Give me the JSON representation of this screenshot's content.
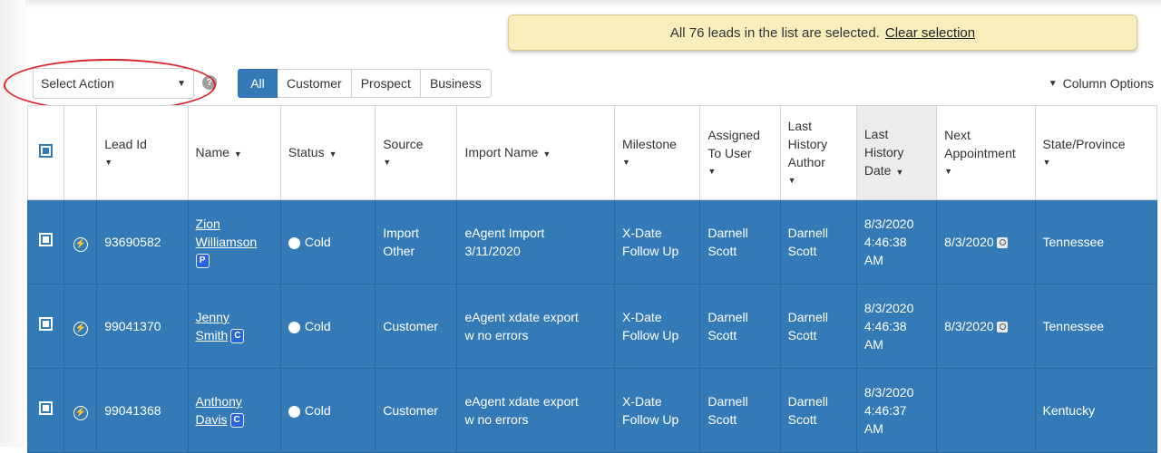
{
  "banner": {
    "text": "All 76 leads in the list are selected.",
    "clear_link": "Clear selection"
  },
  "toolbar": {
    "select_action": "Select Action",
    "help_glyph": "?",
    "tabs": [
      "All",
      "Customer",
      "Prospect",
      "Business"
    ],
    "column_options": "Column Options"
  },
  "table": {
    "headers": {
      "lead_id": "Lead Id",
      "name": "Name",
      "status": "Status",
      "source": "Source",
      "import_name": "Import Name",
      "milestone": "Milestone",
      "assigned_a": "Assigned",
      "assigned_b": "To User",
      "author_a": "Last",
      "author_b": "History",
      "author_c": "Author",
      "date_a": "Last",
      "date_b": "History",
      "date_c": "Date",
      "appt_a": "Next",
      "appt_b": "Appointment",
      "state": "State/Province"
    },
    "rows": [
      {
        "lead_id": "93690582",
        "first": "Zion",
        "last": "Williamson",
        "badge": "P",
        "status": "Cold",
        "source_a": "Import",
        "source_b": "Other",
        "import_a": "eAgent Import",
        "import_b": "3/11/2020",
        "milestone_a": "X-Date",
        "milestone_b": "Follow Up",
        "user_a": "Darnell",
        "user_b": "Scott",
        "author_a": "Darnell",
        "author_b": "Scott",
        "date_a": "8/3/2020",
        "date_b": "4:46:38",
        "date_c": "AM",
        "appointment": "8/3/2020",
        "state": "Tennessee"
      },
      {
        "lead_id": "99041370",
        "first": "Jenny",
        "last": "Smith",
        "badge": "C",
        "status": "Cold",
        "source_a": "Customer",
        "source_b": "",
        "import_a": "eAgent xdate export",
        "import_b": "w no errors",
        "milestone_a": "X-Date",
        "milestone_b": "Follow Up",
        "user_a": "Darnell",
        "user_b": "Scott",
        "author_a": "Darnell",
        "author_b": "Scott",
        "date_a": "8/3/2020",
        "date_b": "4:46:38",
        "date_c": "AM",
        "appointment": "8/3/2020",
        "state": "Tennessee"
      },
      {
        "lead_id": "99041368",
        "first": "Anthony",
        "last": "Davis",
        "badge": "C",
        "status": "Cold",
        "source_a": "Customer",
        "source_b": "",
        "import_a": "eAgent xdate export",
        "import_b": "w no errors",
        "milestone_a": "X-Date",
        "milestone_b": "Follow Up",
        "user_a": "Darnell",
        "user_b": "Scott",
        "author_a": "Darnell",
        "author_b": "Scott",
        "date_a": "8/3/2020",
        "date_b": "4:46:37",
        "date_c": "AM",
        "appointment": "",
        "state": "Kentucky"
      }
    ]
  },
  "colors": {
    "accent": "#337ab7",
    "banner_bg": "#f8eebb",
    "highlight_ring": "#d9262b"
  }
}
